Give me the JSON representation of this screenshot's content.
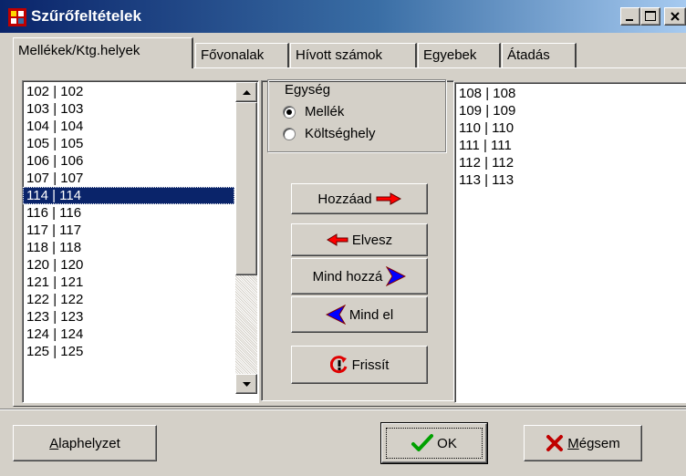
{
  "window": {
    "title": "Szűrőfeltételek",
    "controls": {
      "minimize": "minimize-icon",
      "maximize": "maximize-icon",
      "close": "close-icon"
    }
  },
  "tabs": [
    {
      "label": "Mellékek/Ktg.helyek",
      "active": true
    },
    {
      "label": "Fővonalak",
      "active": false
    },
    {
      "label": "Hívott számok",
      "active": false
    },
    {
      "label": "Egyebek",
      "active": false
    },
    {
      "label": "Átadás",
      "active": false
    }
  ],
  "available_list": {
    "items": [
      "102 | 102",
      "103 | 103",
      "104 | 104",
      "105 | 105",
      "106 | 106",
      "107 | 107",
      "114 | 114",
      "116 | 116",
      "117 | 117",
      "118 | 118",
      "120 | 120",
      "121 | 121",
      "122 | 122",
      "123 | 123",
      "124 | 124",
      "125 | 125"
    ],
    "selected": "114 | 114"
  },
  "unit_group": {
    "legend": "Egység",
    "options": [
      {
        "label": "Mellék",
        "checked": true
      },
      {
        "label": "Költséghely",
        "checked": false
      }
    ]
  },
  "actions": {
    "add": "Hozzáad",
    "remove": "Elvesz",
    "add_all": "Mind hozzá",
    "remove_all": "Mind el",
    "refresh": "Frissít"
  },
  "selected_list": {
    "items": [
      "108 | 108",
      "109 | 109",
      "110 | 110",
      "111 | 111",
      "112 | 112",
      "113 | 113"
    ]
  },
  "footer": {
    "reset": {
      "underline": "A",
      "rest": "laphelyzet"
    },
    "ok": "OK",
    "cancel": {
      "underline": "M",
      "rest": "égsem"
    }
  },
  "colors": {
    "face": "#d4d0c8",
    "title_start": "#0a246a",
    "title_end": "#a6caf0",
    "selection": "#0a246a",
    "add_arrow": "#ff0000",
    "all_arrow": "#0000ff",
    "ok_check": "#00a000",
    "cancel_x": "#c00000"
  }
}
